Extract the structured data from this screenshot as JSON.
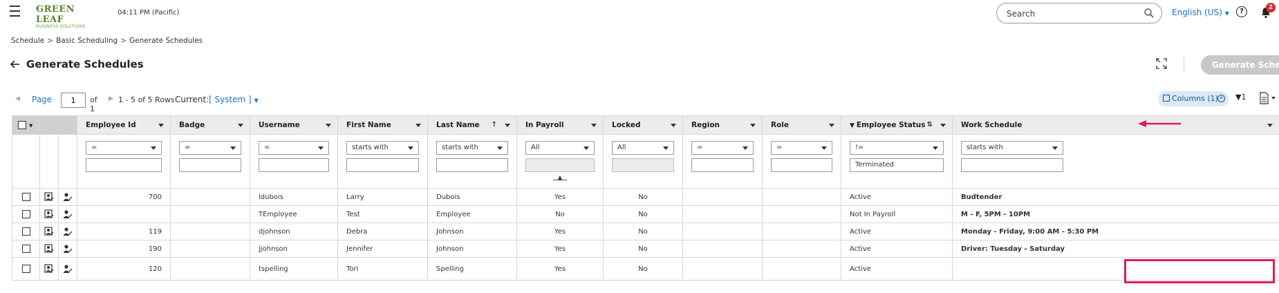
{
  "header": {
    "logo_line1": "GREEN LEAF",
    "logo_line2": "BUSINESS SOLUTIONS",
    "time": "04:11 PM (Pacific)",
    "search_placeholder": "Search",
    "language": "English (US)",
    "notification_count": "2"
  },
  "breadcrumb": [
    "Schedule",
    "Basic Scheduling",
    "Generate Schedules"
  ],
  "page_title": "Generate Schedules",
  "generate_button": "Generate Schedul",
  "pager": {
    "page_label": "Page",
    "page_value": "1",
    "of": "of 1",
    "rows": "1 - 5 of 5 Rows",
    "current_label": "Current:",
    "current_value": "[ System ]"
  },
  "toolbar": {
    "columns_label": "Columns (1)",
    "filter_count": "1"
  },
  "columns": [
    {
      "key": "employee_id",
      "label": "Employee Id",
      "op": "=",
      "value": ""
    },
    {
      "key": "badge",
      "label": "Badge",
      "op": "=",
      "value": ""
    },
    {
      "key": "username",
      "label": "Username",
      "op": "=",
      "value": ""
    },
    {
      "key": "first_name",
      "label": "First Name",
      "op": "starts with",
      "value": ""
    },
    {
      "key": "last_name",
      "label": "Last Name",
      "op": "starts with",
      "value": ""
    },
    {
      "key": "in_payroll",
      "label": "In Payroll",
      "op": "All",
      "value": ""
    },
    {
      "key": "locked",
      "label": "Locked",
      "op": "All",
      "value": ""
    },
    {
      "key": "region",
      "label": "Region",
      "op": "=",
      "value": ""
    },
    {
      "key": "role",
      "label": "Role",
      "op": "=",
      "value": ""
    },
    {
      "key": "employee_status",
      "label": "Employee Status",
      "op": "!=",
      "value": "Terminated"
    },
    {
      "key": "work_schedule",
      "label": "Work Schedule",
      "op": "starts with",
      "value": ""
    }
  ],
  "rows": [
    {
      "employee_id": "700",
      "badge": "",
      "username": "ldubois",
      "first_name": "Larry",
      "last_name": "Dubois",
      "in_payroll": "Yes",
      "locked": "No",
      "region": "",
      "role": "",
      "employee_status": "Active",
      "work_schedule": "Budtender"
    },
    {
      "employee_id": "",
      "badge": "",
      "username": "TEmployee",
      "first_name": "Test",
      "last_name": "Employee",
      "in_payroll": "No",
      "locked": "No",
      "region": "",
      "role": "",
      "employee_status": "Not In Payroll",
      "work_schedule": "M - F, 5PM - 10PM"
    },
    {
      "employee_id": "119",
      "badge": "",
      "username": "djohnson",
      "first_name": "Debra",
      "last_name": "Johnson",
      "in_payroll": "Yes",
      "locked": "No",
      "region": "",
      "role": "",
      "employee_status": "Active",
      "work_schedule": "Monday - Friday, 9:00 AM - 5:30 PM"
    },
    {
      "employee_id": "190",
      "badge": "",
      "username": "jjohnson",
      "first_name": "Jennifer",
      "last_name": "Johnson",
      "in_payroll": "Yes",
      "locked": "No",
      "region": "",
      "role": "",
      "employee_status": "Active",
      "work_schedule": "Driver: Tuesday - Saturday"
    },
    {
      "employee_id": "120",
      "badge": "",
      "username": "tspelling",
      "first_name": "Tori",
      "last_name": "Spelling",
      "in_payroll": "Yes",
      "locked": "No",
      "region": "",
      "role": "",
      "employee_status": "Active",
      "work_schedule": ""
    }
  ],
  "colors": {
    "accent": "#1f6fc5",
    "highlight": "#e5195a",
    "notification": "#d9262c"
  }
}
